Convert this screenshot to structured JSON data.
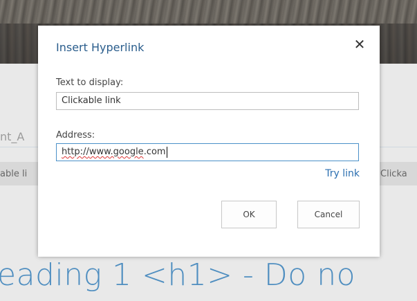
{
  "background": {
    "breadcrumb_fragment": "nt_A",
    "row_left_fragment": "able li",
    "row_right_fragment": "Clicka",
    "heading_fragment": "eading 1 <h1> - Do no"
  },
  "dialog": {
    "title": "Insert Hyperlink",
    "close_glyph": "✕",
    "text_label": "Text to display:",
    "text_value": "Clickable link",
    "address_label": "Address:",
    "address_prefix": "http://",
    "address_misspelled": "www.google",
    "address_suffix": ".com",
    "try_link": "Try link",
    "ok_label": "OK",
    "cancel_label": "Cancel"
  },
  "colors": {
    "accent": "#2a5d8c",
    "link": "#2a6eb0",
    "focus_border": "#4a90c8",
    "heading": "#4f8ec0"
  }
}
